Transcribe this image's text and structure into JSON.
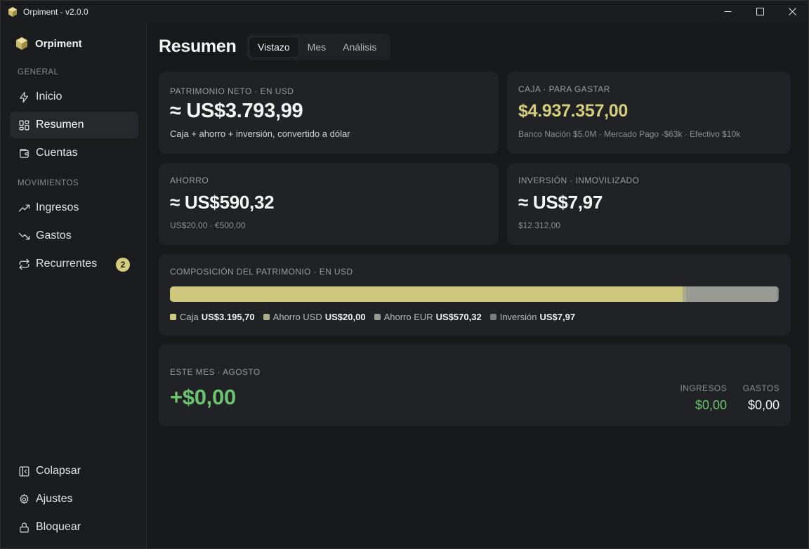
{
  "window": {
    "title": "Orpiment - v2.0.0",
    "controls": [
      "minimize-icon",
      "maximize-icon",
      "close-icon"
    ]
  },
  "sidebar": {
    "brand": "Orpiment",
    "sections": [
      {
        "label": "GENERAL",
        "items": [
          {
            "label": "Inicio",
            "icon": "bolt-icon"
          },
          {
            "label": "Resumen",
            "icon": "grid-icon",
            "active": true
          },
          {
            "label": "Cuentas",
            "icon": "wallet-icon"
          }
        ]
      },
      {
        "label": "MOVIMIENTOS",
        "items": [
          {
            "label": "Ingresos",
            "icon": "trend-up-icon"
          },
          {
            "label": "Gastos",
            "icon": "trend-down-icon"
          },
          {
            "label": "Recurrentes",
            "icon": "repeat-icon",
            "badge": "2"
          }
        ]
      }
    ],
    "footer": [
      {
        "label": "Colapsar",
        "icon": "collapse-icon"
      },
      {
        "label": "Ajustes",
        "icon": "gear-icon"
      },
      {
        "label": "Bloquear",
        "icon": "lock-icon"
      }
    ]
  },
  "header": {
    "title": "Resumen",
    "tabs": [
      {
        "label": "Vistazo",
        "active": true
      },
      {
        "label": "Mes"
      },
      {
        "label": "Análisis"
      }
    ]
  },
  "cards": {
    "net_worth": {
      "label": "PATRIMONIO NETO · EN USD",
      "value": "≈ US$3.793,99",
      "description": "Caja + ahorro + inversión, convertido a dólar"
    },
    "cash": {
      "label": "CAJA · PARA GASTAR",
      "value": "$4.937.357,00",
      "detail": "Banco Nación $5.0M · Mercado Pago -$63k · Efectivo $10k"
    },
    "savings": {
      "label": "AHORRO",
      "value": "≈ US$590,32",
      "detail": "US$20,00 · €500,00"
    },
    "investment": {
      "label": "INVERSIÓN · INMOVILIZADO",
      "value": "≈ US$7,97",
      "detail": "$12.312,00"
    },
    "composition": {
      "label": "COMPOSICIÓN DEL PATRIMONIO · EN USD",
      "segments": [
        {
          "name": "Caja",
          "display": "US$3.195,70",
          "amount": 3195.7,
          "color": "#cfc67e"
        },
        {
          "name": "Ahorro USD",
          "display": "US$20,00",
          "amount": 20.0,
          "color": "#aeab8a"
        },
        {
          "name": "Ahorro EUR",
          "display": "US$570,32",
          "amount": 570.32,
          "color": "#9a9a94"
        },
        {
          "name": "Inversión",
          "display": "US$7,97",
          "amount": 7.97,
          "color": "#7c7d80"
        }
      ]
    },
    "month": {
      "label": "ESTE MES · AGOSTO",
      "value": "+$0,00",
      "income_label": "INGRESOS",
      "income_value": "$0,00",
      "expense_label": "GASTOS",
      "expense_value": "$0,00"
    }
  },
  "colors": {
    "accent_gold": "#d4cc7c",
    "positive_green": "#6bc46d",
    "card_bg": "#212225",
    "app_bg": "#18191b"
  }
}
